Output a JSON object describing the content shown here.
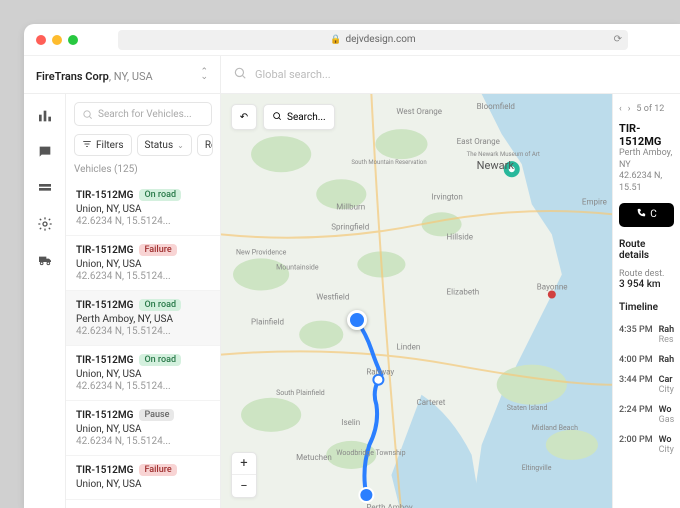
{
  "browser": {
    "url": "dejvdesign.com"
  },
  "org": {
    "name": "FireTrans Corp",
    "location": "NY, USA"
  },
  "global_search_placeholder": "Global search...",
  "sidebar": {
    "search_placeholder": "Search for Vehicles...",
    "filters_label": "Filters",
    "status_label": "Status",
    "region_label": "Regio",
    "count_label": "Vehicles (125)"
  },
  "vehicles": [
    {
      "id": "TIR-1512MG",
      "status": "On road",
      "status_cls": "onroad",
      "loc": "Union, NY, USA",
      "coords": "42.6234 N, 15.5124..."
    },
    {
      "id": "TIR-1512MG",
      "status": "Failure",
      "status_cls": "failure",
      "loc": "Union, NY, USA",
      "coords": "42.6234 N, 15.5124..."
    },
    {
      "id": "TIR-1512MG",
      "status": "On road",
      "status_cls": "onroad",
      "loc": "Perth Amboy, NY, USA",
      "coords": "42.6234 N, 15.5124..."
    },
    {
      "id": "TIR-1512MG",
      "status": "On road",
      "status_cls": "onroad",
      "loc": "Union, NY, USA",
      "coords": "42.6234 N, 15.5124..."
    },
    {
      "id": "TIR-1512MG",
      "status": "Pause",
      "status_cls": "pause",
      "loc": "Union, NY, USA",
      "coords": "42.6234 N, 15.5124..."
    },
    {
      "id": "TIR-1512MG",
      "status": "Failure",
      "status_cls": "failure",
      "loc": "Union, NY, USA",
      "coords": ""
    }
  ],
  "map": {
    "search_label": "Search...",
    "labels": [
      "Newark",
      "Elizabeth",
      "Plainfield",
      "Bayonne",
      "Perth Amboy",
      "Woodbridge Township",
      "Carteret",
      "Rahway",
      "Linden",
      "Hillside",
      "Irvington",
      "Millburn",
      "Springfield",
      "Westfield",
      "Metuchen",
      "Iselin",
      "South Plainfield",
      "New Providence",
      "Mountainside",
      "Bloomfield",
      "West Orange",
      "East Orange",
      "Staten Island",
      "Midland Beach",
      "Eltingville",
      "Empire",
      "South Mountain Reservation",
      "The Newark Museum of Art"
    ]
  },
  "details": {
    "pager": "5 of 12",
    "title": "TIR-1512MG",
    "sub1": "Perth Amboy, NY",
    "sub2": "42.6234 N, 15.51",
    "call_label": "C",
    "route_title": "Route details",
    "dest_label": "Route dest.",
    "dest_value": "3 954 km",
    "timeline_label": "Timeline",
    "timeline": [
      {
        "time": "4:35 PM",
        "t": "Rah",
        "s": "Res"
      },
      {
        "time": "4:00 PM",
        "t": "Rah",
        "s": ""
      },
      {
        "time": "3:44 PM",
        "t": "Car",
        "s": "City"
      },
      {
        "time": "2:24 PM",
        "t": "Wo",
        "s": "Gas"
      },
      {
        "time": "2:00 PM",
        "t": "Wo",
        "s": "City"
      }
    ]
  }
}
